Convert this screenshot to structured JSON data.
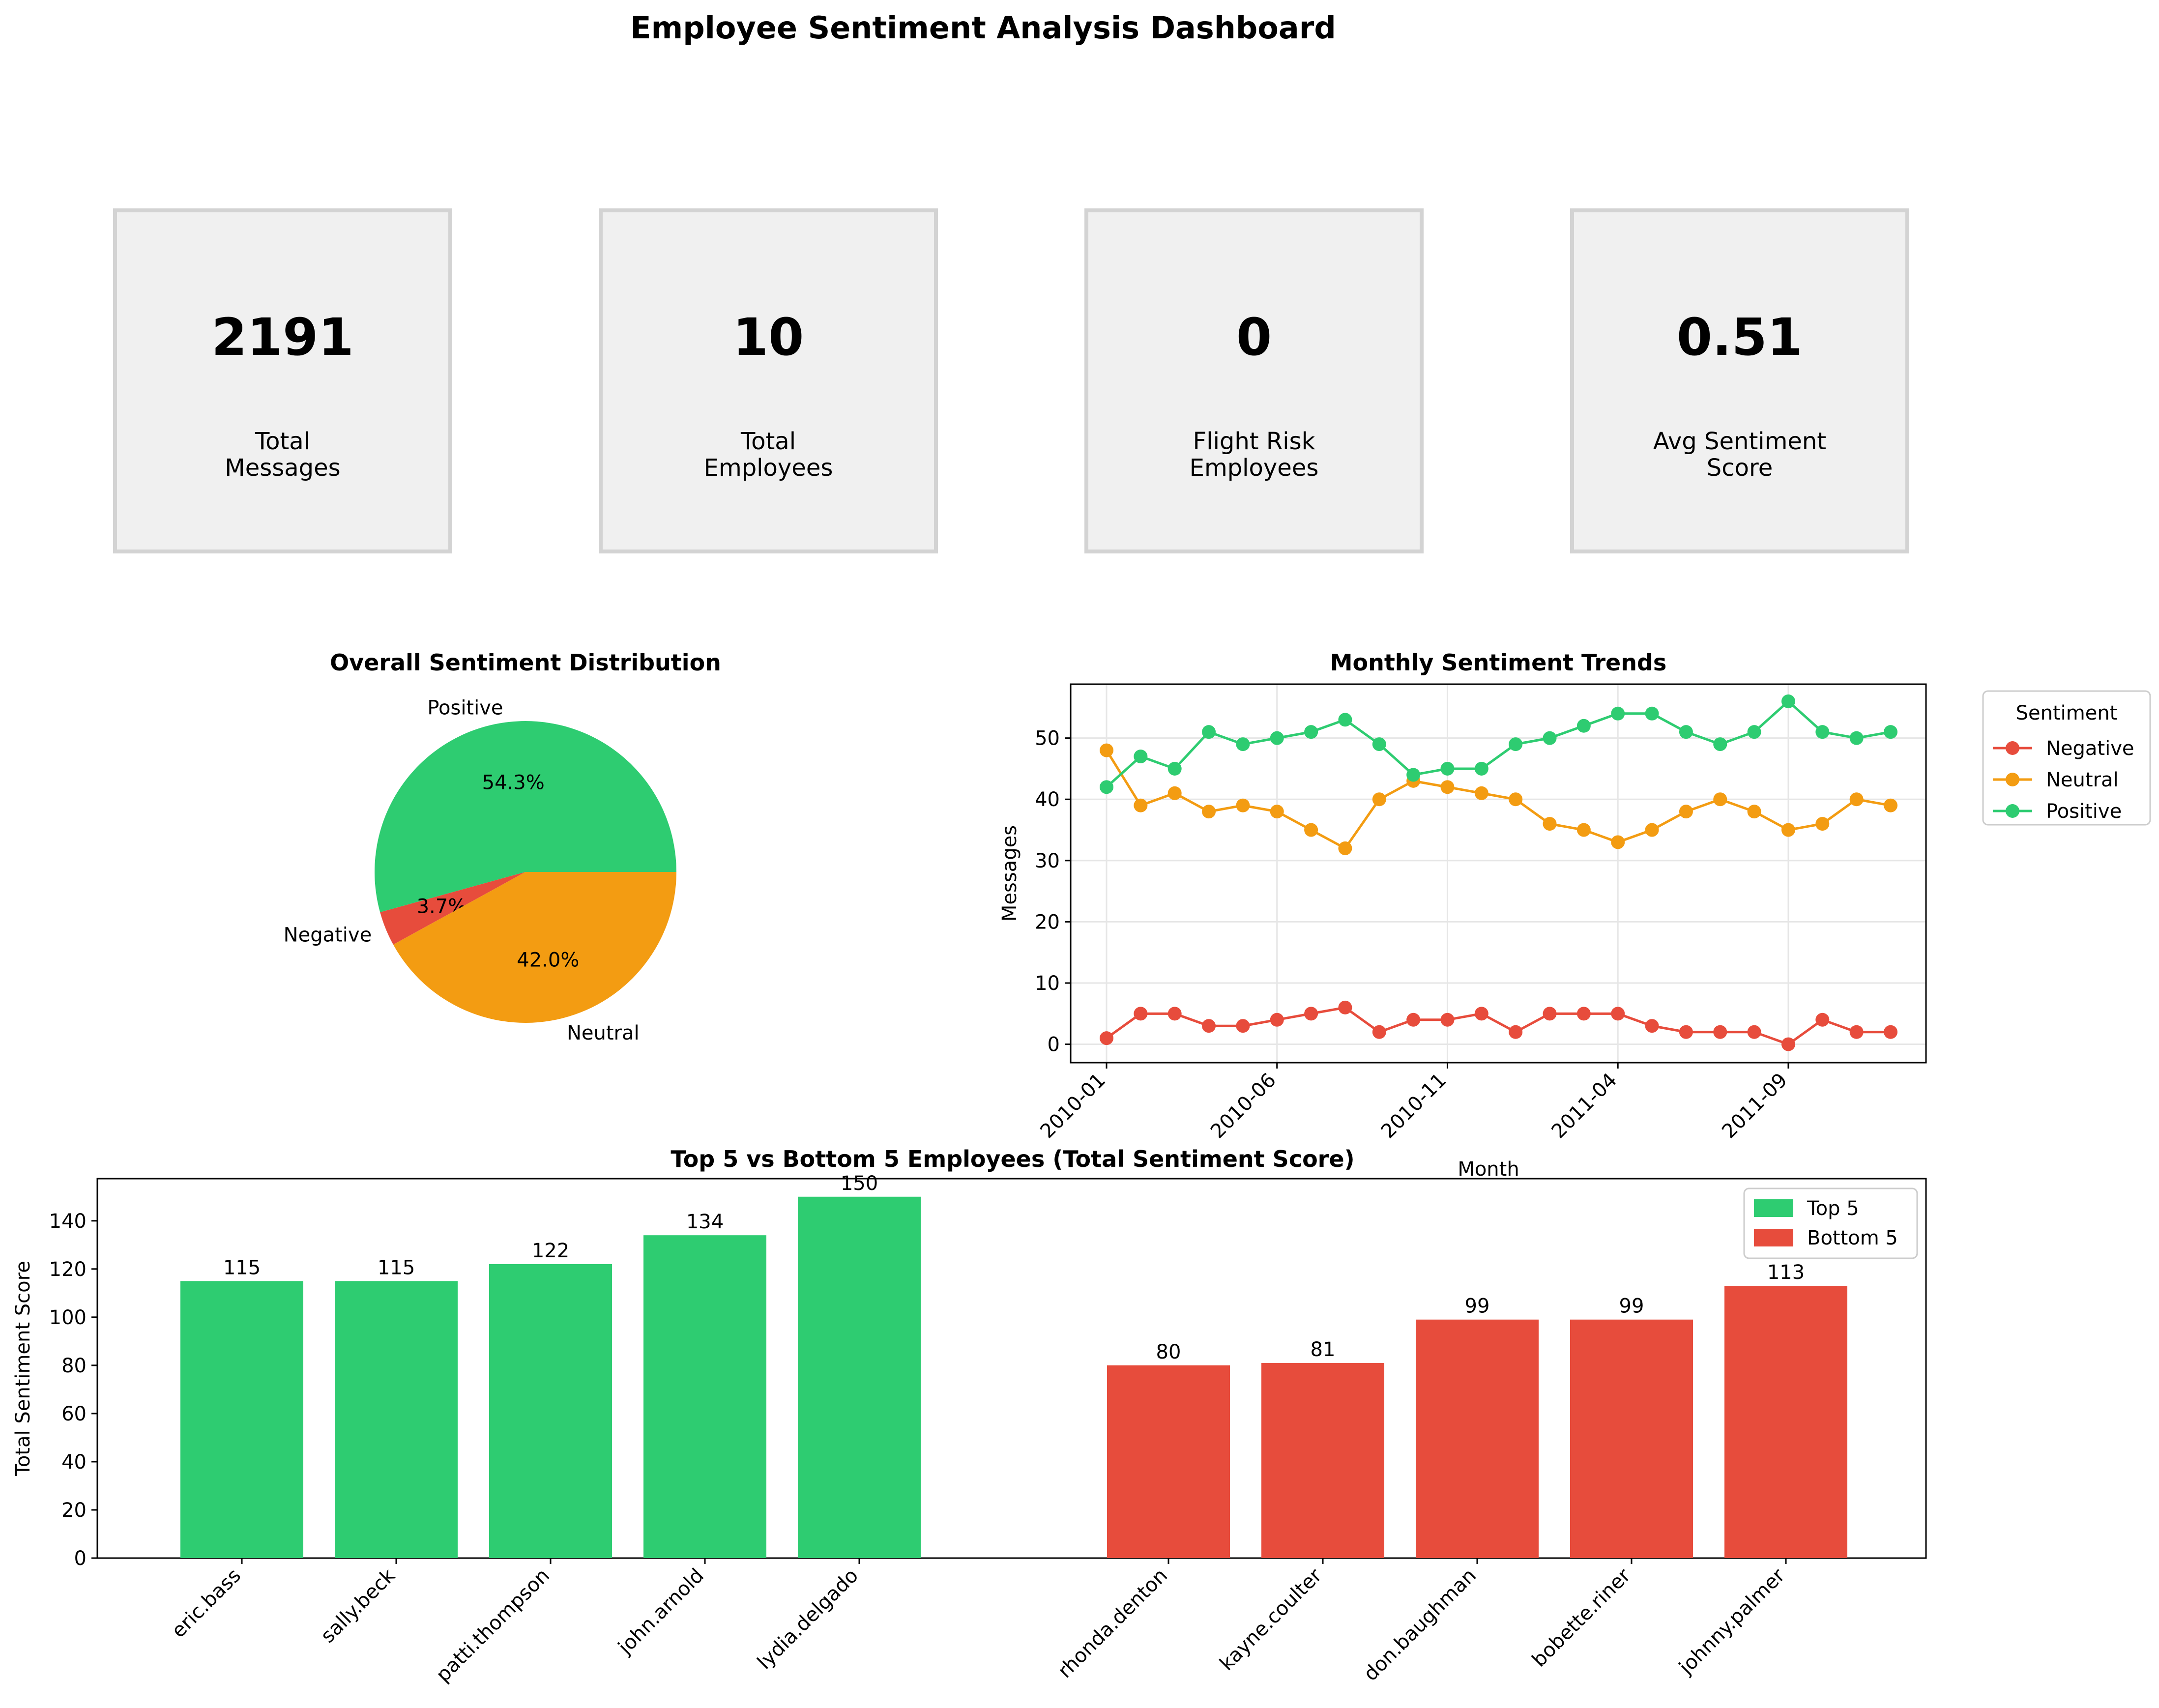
{
  "title": "Employee Sentiment Analysis Dashboard",
  "kpis": [
    {
      "value": "2191",
      "label_lines": [
        "Total",
        "Messages"
      ]
    },
    {
      "value": "10",
      "label_lines": [
        "Total",
        "Employees"
      ]
    },
    {
      "value": "0",
      "label_lines": [
        "Flight Risk",
        "Employees"
      ]
    },
    {
      "value": "0.51",
      "label_lines": [
        "Avg Sentiment",
        "Score"
      ]
    }
  ],
  "colors": {
    "positive": "#2ecc71",
    "neutral": "#f39c12",
    "negative": "#e74c3c",
    "card_bg": "#f0f0f0",
    "card_border": "#d3d3d3"
  },
  "chart_data": [
    {
      "type": "pie",
      "title": "Overall Sentiment Distribution",
      "slices": [
        {
          "label": "Positive",
          "value": 54.3,
          "pct_label": "54.3%",
          "color": "#2ecc71"
        },
        {
          "label": "Negative",
          "value": 3.7,
          "pct_label": "3.7%",
          "color": "#e74c3c"
        },
        {
          "label": "Neutral",
          "value": 42.0,
          "pct_label": "42.0%",
          "color": "#f39c12"
        }
      ]
    },
    {
      "type": "line",
      "title": "Monthly Sentiment Trends",
      "xlabel": "Month",
      "ylabel": "Messages",
      "ylim": [
        -3,
        58.8
      ],
      "yticks": [
        0,
        10,
        20,
        30,
        40,
        50
      ],
      "x": [
        "2010-01",
        "2010-02",
        "2010-03",
        "2010-04",
        "2010-05",
        "2010-06",
        "2010-07",
        "2010-08",
        "2010-09",
        "2010-10",
        "2010-11",
        "2010-12",
        "2011-01",
        "2011-02",
        "2011-03",
        "2011-04",
        "2011-05",
        "2011-06",
        "2011-07",
        "2011-08",
        "2011-09",
        "2011-10",
        "2011-11",
        "2011-12"
      ],
      "xtick_labels": [
        "2010-01",
        "2010-06",
        "2010-11",
        "2011-04",
        "2011-09"
      ],
      "grid": true,
      "legend": {
        "title": "Sentiment",
        "placement": "outside right"
      },
      "series": [
        {
          "name": "Negative",
          "color": "#e74c3c",
          "values": [
            1,
            5,
            5,
            3,
            3,
            4,
            5,
            6,
            2,
            4,
            4,
            5,
            2,
            5,
            5,
            5,
            3,
            2,
            2,
            2,
            0,
            4,
            2,
            2
          ]
        },
        {
          "name": "Neutral",
          "color": "#f39c12",
          "values": [
            48,
            39,
            41,
            38,
            39,
            38,
            35,
            32,
            40,
            43,
            42,
            41,
            40,
            36,
            35,
            33,
            35,
            38,
            40,
            38,
            35,
            36,
            40,
            39
          ]
        },
        {
          "name": "Positive",
          "color": "#2ecc71",
          "values": [
            42,
            47,
            45,
            51,
            49,
            50,
            51,
            53,
            49,
            44,
            45,
            45,
            49,
            50,
            52,
            54,
            54,
            51,
            49,
            51,
            56,
            51,
            50,
            51
          ]
        }
      ]
    },
    {
      "type": "bar",
      "title": "Top 5 vs Bottom 5 Employees (Total Sentiment Score)",
      "ylabel": "Total Sentiment Score",
      "ylim": [
        0,
        157.5
      ],
      "yticks": [
        0,
        20,
        40,
        60,
        80,
        100,
        120,
        140
      ],
      "legend": {
        "placement": "top-right"
      },
      "series": [
        {
          "name": "Top 5",
          "color": "#2ecc71",
          "categories": [
            "eric.bass",
            "sally.beck",
            "patti.thompson",
            "john.arnold",
            "lydia.delgado"
          ],
          "values": [
            115,
            115,
            122,
            134,
            150
          ]
        },
        {
          "name": "Bottom 5",
          "color": "#e74c3c",
          "categories": [
            "rhonda.denton",
            "kayne.coulter",
            "don.baughman",
            "bobette.riner",
            "johnny.palmer"
          ],
          "values": [
            80,
            81,
            99,
            99,
            113
          ]
        }
      ]
    }
  ]
}
